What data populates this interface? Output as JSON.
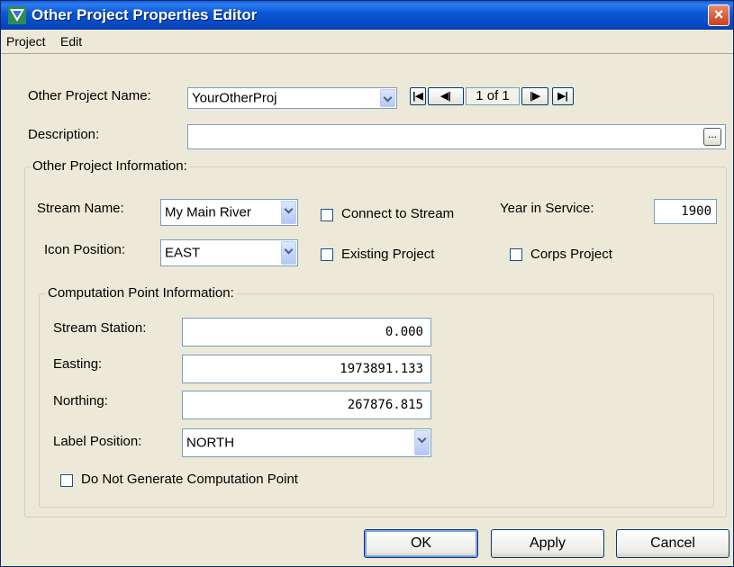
{
  "window": {
    "title": "Other Project Properties Editor",
    "close_label": "×"
  },
  "menu": {
    "items": [
      "Project",
      "Edit"
    ]
  },
  "header": {
    "name_label": "Other Project Name:",
    "name_value": "YourOtherProj",
    "pager": "1 of 1",
    "nav": {
      "first": "|◀",
      "prev": "◀|",
      "next": "|▶",
      "last": "▶|"
    },
    "description_label": "Description:",
    "description_value": "",
    "description_button": "..."
  },
  "project_info": {
    "legend": "Other Project Information:",
    "stream_label": "Stream Name:",
    "stream_value": "My Main River",
    "connect_label": "Connect to Stream",
    "connect_checked": false,
    "year_label": "Year in Service:",
    "year_value": "1900",
    "icon_label": "Icon Position:",
    "icon_value": "EAST",
    "existing_label": "Existing Project",
    "existing_checked": false,
    "corps_label": "Corps Project",
    "corps_checked": false
  },
  "computation": {
    "legend": "Computation Point Information:",
    "station_label": "Stream Station:",
    "station_value": "0.000",
    "easting_label": "Easting:",
    "easting_value": "1973891.133",
    "northing_label": "Northing:",
    "northing_value": "267876.815",
    "label_pos_label": "Label Position:",
    "label_pos_value": "NORTH",
    "no_generate_label": "Do Not Generate Computation Point",
    "no_generate_checked": false
  },
  "buttons": {
    "ok": "OK",
    "apply": "Apply",
    "cancel": "Cancel"
  },
  "colors": {
    "titlebar": "#0A5FD8",
    "dialog_bg": "#ECE9D8",
    "field_border": "#7F9DB9"
  }
}
